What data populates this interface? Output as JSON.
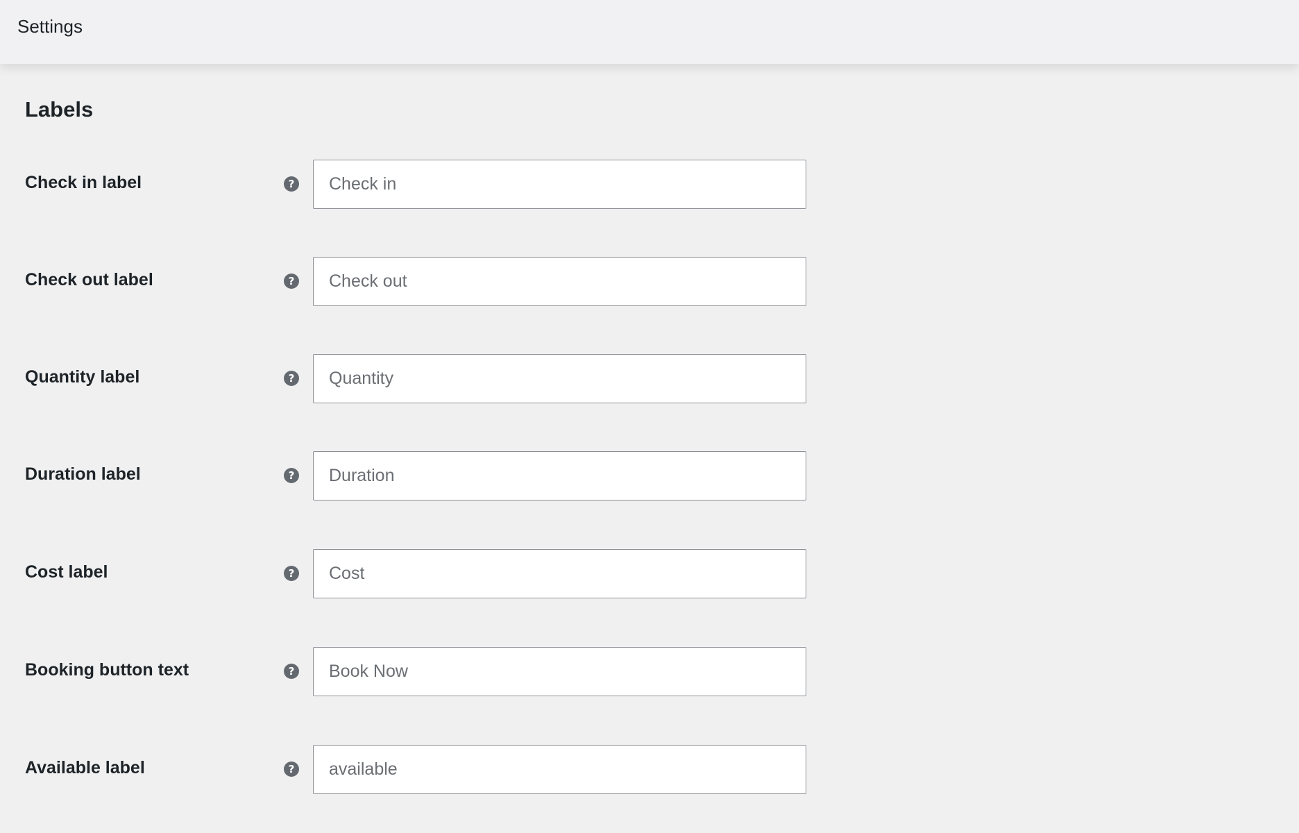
{
  "header": {
    "title": "Settings"
  },
  "section": {
    "title": "Labels"
  },
  "fields": [
    {
      "label": "Check in label",
      "value": "",
      "placeholder": "Check in",
      "icon": "help-icon"
    },
    {
      "label": "Check out label",
      "value": "",
      "placeholder": "Check out",
      "icon": "help-icon"
    },
    {
      "label": "Quantity label",
      "value": "",
      "placeholder": "Quantity",
      "icon": "help-icon"
    },
    {
      "label": "Duration label",
      "value": "",
      "placeholder": "Duration",
      "icon": "help-icon"
    },
    {
      "label": "Cost label",
      "value": "",
      "placeholder": "Cost",
      "icon": "help-icon"
    },
    {
      "label": "Booking button text",
      "value": "",
      "placeholder": "Book Now",
      "icon": "help-icon"
    },
    {
      "label": "Available label",
      "value": "",
      "placeholder": "available",
      "icon": "help-icon"
    }
  ],
  "help_glyph": "?"
}
